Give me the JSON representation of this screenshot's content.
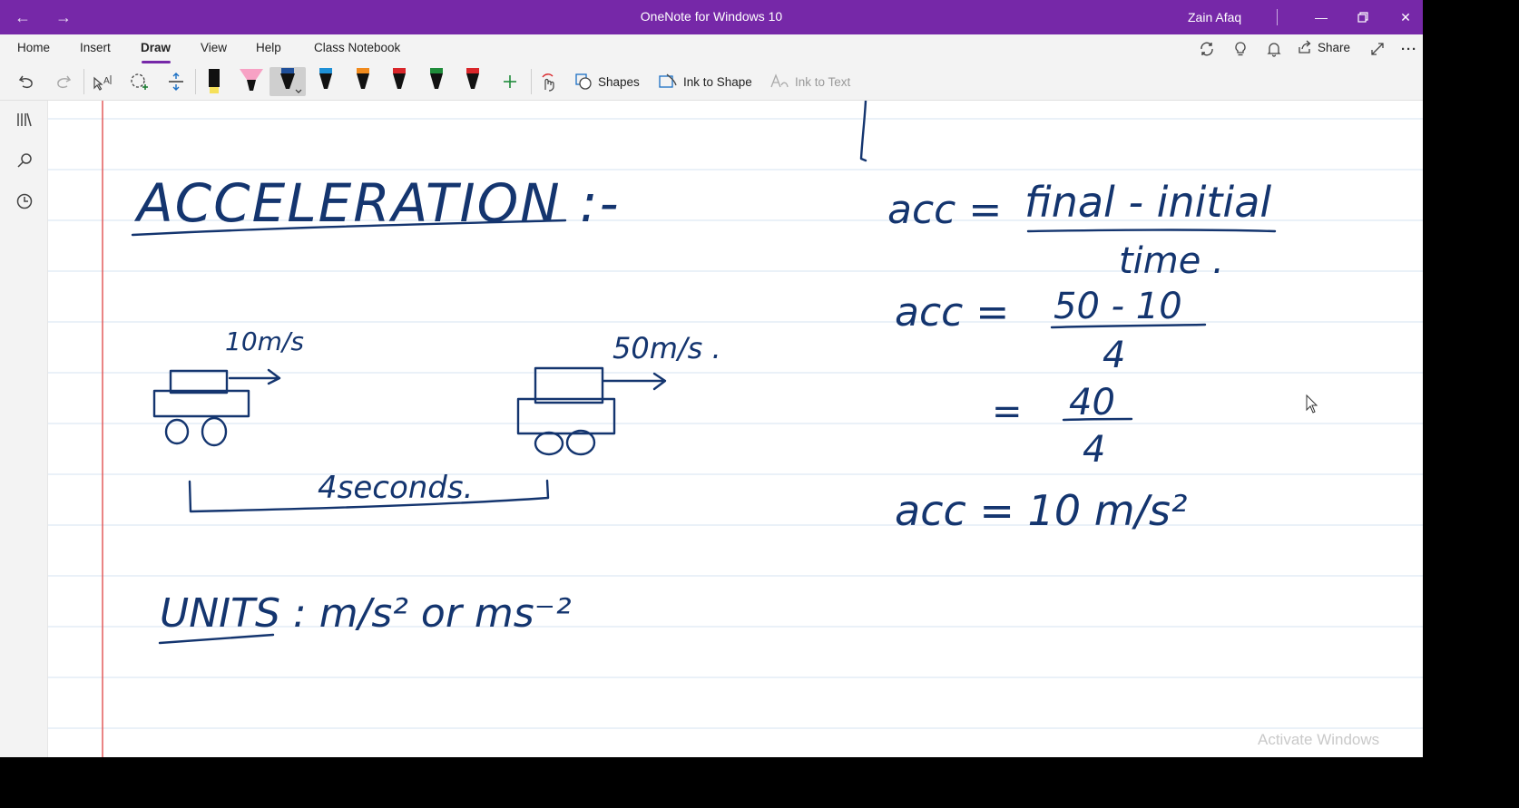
{
  "window": {
    "title": "OneNote for Windows 10",
    "user": "Zain Afaq",
    "controls": [
      "minimize-icon",
      "restore-icon",
      "close-icon"
    ]
  },
  "menu": {
    "tabs": [
      "Home",
      "Insert",
      "Draw",
      "View",
      "Help",
      "Class Notebook"
    ],
    "active_tab": "Draw",
    "share_label": "Share"
  },
  "toolbar": {
    "shapes_label": "Shapes",
    "ink_to_shape_label": "Ink to Shape",
    "ink_to_text_label": "Ink to Text",
    "pens": [
      {
        "kind": "highlighter",
        "color": "#f5e05a"
      },
      {
        "kind": "highlighter",
        "color": "#f7a1c4"
      },
      {
        "kind": "pen",
        "color": "#1f4f99",
        "selected": true
      },
      {
        "kind": "pen",
        "color": "#1e90d6"
      },
      {
        "kind": "pen",
        "color": "#f08a1c"
      },
      {
        "kind": "pen",
        "color": "#d9262a"
      },
      {
        "kind": "pen",
        "color": "#1f8c3b"
      },
      {
        "kind": "pen",
        "color": "#d9262a"
      }
    ]
  },
  "note": {
    "heading": "ACCELERATION :-",
    "car_start_speed": "10m/s",
    "car_end_speed": "50m/s .",
    "duration": "4seconds.",
    "units": "UNITS : m/s² or ms⁻²",
    "formula": {
      "line1_lhs": "acc =",
      "line1_num": "final - initial",
      "line1_den": "time .",
      "line2_lhs": "acc =",
      "line2_num": "50 - 10",
      "line2_den": "4",
      "line3_eq": "=",
      "line3_num": "40",
      "line3_den": "4",
      "result": "acc = 10 m/s²"
    }
  },
  "watermark": "Activate Windows"
}
